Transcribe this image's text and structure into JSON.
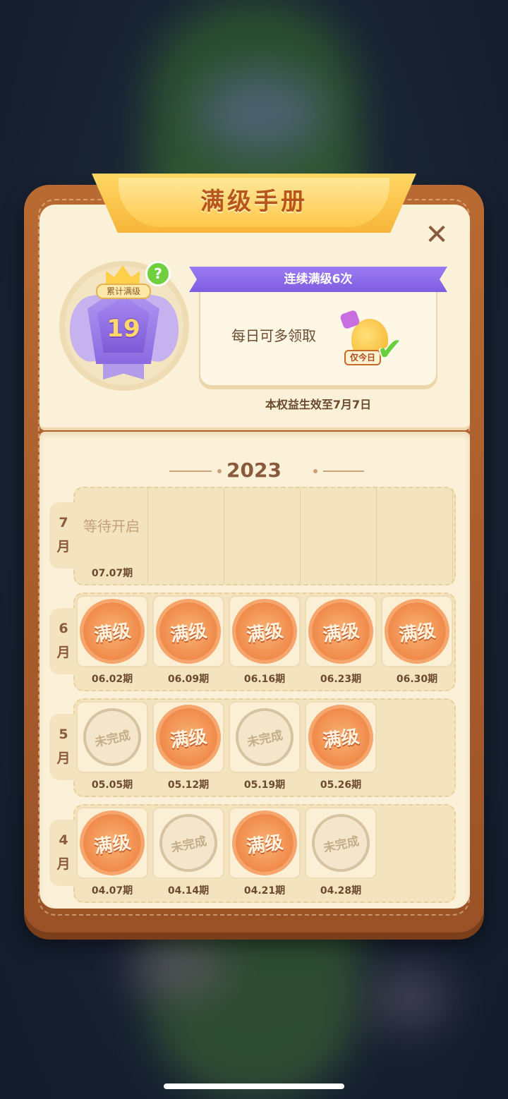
{
  "title": "满级手册",
  "badge": {
    "label": "累计满级",
    "count": "19",
    "help_icon": "question-icon"
  },
  "streak": {
    "ribbon": "连续满级6次",
    "text": "每日可多领取",
    "item_tag": "仅今日",
    "valid_until": "本权益生效至7月7日"
  },
  "year": "2023",
  "pending_label": "等待开启",
  "months": [
    {
      "label": "7月",
      "periods": [
        {
          "period": "07.07期",
          "status": "pending"
        }
      ]
    },
    {
      "label": "6月",
      "periods": [
        {
          "period": "06.02期",
          "status": "满级"
        },
        {
          "period": "06.09期",
          "status": "满级"
        },
        {
          "period": "06.16期",
          "status": "满级"
        },
        {
          "period": "06.23期",
          "status": "满级"
        },
        {
          "period": "06.30期",
          "status": "满级"
        }
      ]
    },
    {
      "label": "5月",
      "periods": [
        {
          "period": "05.05期",
          "status": "未完成"
        },
        {
          "period": "05.12期",
          "status": "满级"
        },
        {
          "period": "05.19期",
          "status": "未完成"
        },
        {
          "period": "05.26期",
          "status": "满级"
        }
      ]
    },
    {
      "label": "4月",
      "periods": [
        {
          "period": "04.07期",
          "status": "满级"
        },
        {
          "period": "04.14期",
          "status": "未完成"
        },
        {
          "period": "04.21期",
          "status": "满级"
        },
        {
          "period": "04.28期",
          "status": "未完成"
        }
      ]
    }
  ],
  "colors": {
    "accent_purple": "#8b6ae0",
    "stamp_full": "#f08a4a",
    "stamp_incomplete": "#d6c3a1",
    "frame_brown": "#b96a33"
  }
}
